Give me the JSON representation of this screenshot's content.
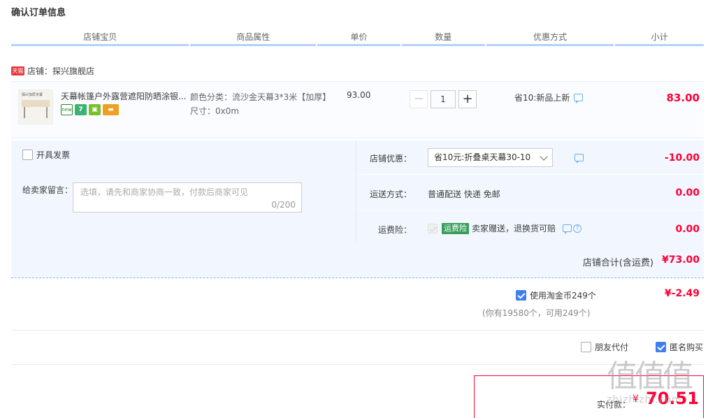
{
  "page": {
    "title": "确认订单信息"
  },
  "columns": [
    "店铺宝贝",
    "商品属性",
    "单价",
    "数量",
    "优惠方式",
    "小计"
  ],
  "shop": {
    "badge": "天猫",
    "name": "店铺：探兴旗舰店"
  },
  "item": {
    "thumb_title": "探兴加厚天幕",
    "title": "天幕帐篷户外露营遮阳防晒涂银...",
    "icons": [
      "new",
      "7",
      "shield",
      "card"
    ],
    "attr_color": "颜色分类：流沙金天幕3*3米【加厚】",
    "attr_size": "尺寸：0x0m",
    "price": "93.00",
    "quantity_minus": "−",
    "quantity": "1",
    "quantity_plus": "+",
    "promo": "省10:新品上新",
    "subtotal": "83.00"
  },
  "order": {
    "invoice_label": "开具发票",
    "memo_label": "给卖家留言：",
    "memo_placeholder": "选填，请先和商家协商一致，付款后商家可见",
    "memo_counter": "0/200",
    "shop_discount_label": "店铺优惠：",
    "shop_discount_value": "省10元:折叠桌天幕30-10",
    "shop_discount_amount": "-10.00",
    "shipping_label": "运送方式：",
    "shipping_value": "普通配送 快递 免邮",
    "shipping_amount": "0.00",
    "insurance_label": "运费险：",
    "insurance_badge": "运费险",
    "insurance_text": "卖家赠送，退换货可赔",
    "insurance_amount": "0.00",
    "shop_total_label": "店铺合计(含运费)",
    "shop_total_amount": "¥73.00"
  },
  "coins": {
    "label": "使用淘金币249个",
    "amount": "¥-2.49",
    "note": "(你有19580个，可用249个)",
    "checked": true
  },
  "options": {
    "friend_pay_label": "朋友代付",
    "friend_pay_checked": false,
    "anonymous_label": "匿名购买",
    "anonymous_checked": true
  },
  "payment": {
    "label": "实付款：",
    "currency": "¥",
    "amount": "70.51"
  },
  "watermark": {
    "big": "值值值",
    "small": "zhizhizhi.com"
  },
  "colors": {
    "price_red": "#ff0036",
    "header_border": "#b2d1ff",
    "panel_bg": "#f2f7ff",
    "check_blue": "#3d7ef0"
  }
}
